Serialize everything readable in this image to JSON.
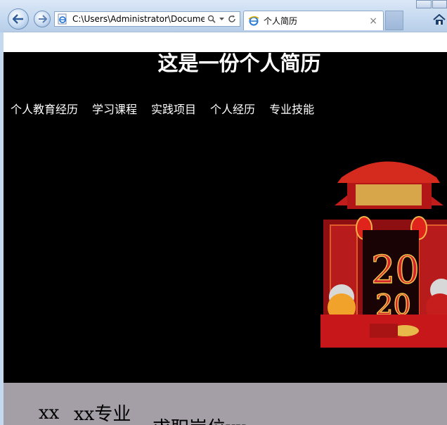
{
  "browser": {
    "address": "C:\\Users\\Administrator\\Docume",
    "tab_title": "个人简历",
    "tab_close": "×",
    "icons": [
      "back-arrow-icon",
      "forward-arrow-icon",
      "ie-page-icon",
      "search-icon",
      "dropdown-icon",
      "refresh-icon",
      "home-icon"
    ]
  },
  "page": {
    "title": "这是一份个人简历",
    "nav": [
      "个人教育经历",
      "学习课程",
      "实践项目",
      "个人经历",
      "专业技能"
    ],
    "banner_alt": "2020 新年鼠年插画",
    "profile": {
      "name": "xx",
      "major": "xx专业",
      "job": "求职岗位xx"
    }
  },
  "colors": {
    "page_bg": "#000000",
    "text": "#ffffff",
    "profile_bg": "#a49ea6"
  }
}
